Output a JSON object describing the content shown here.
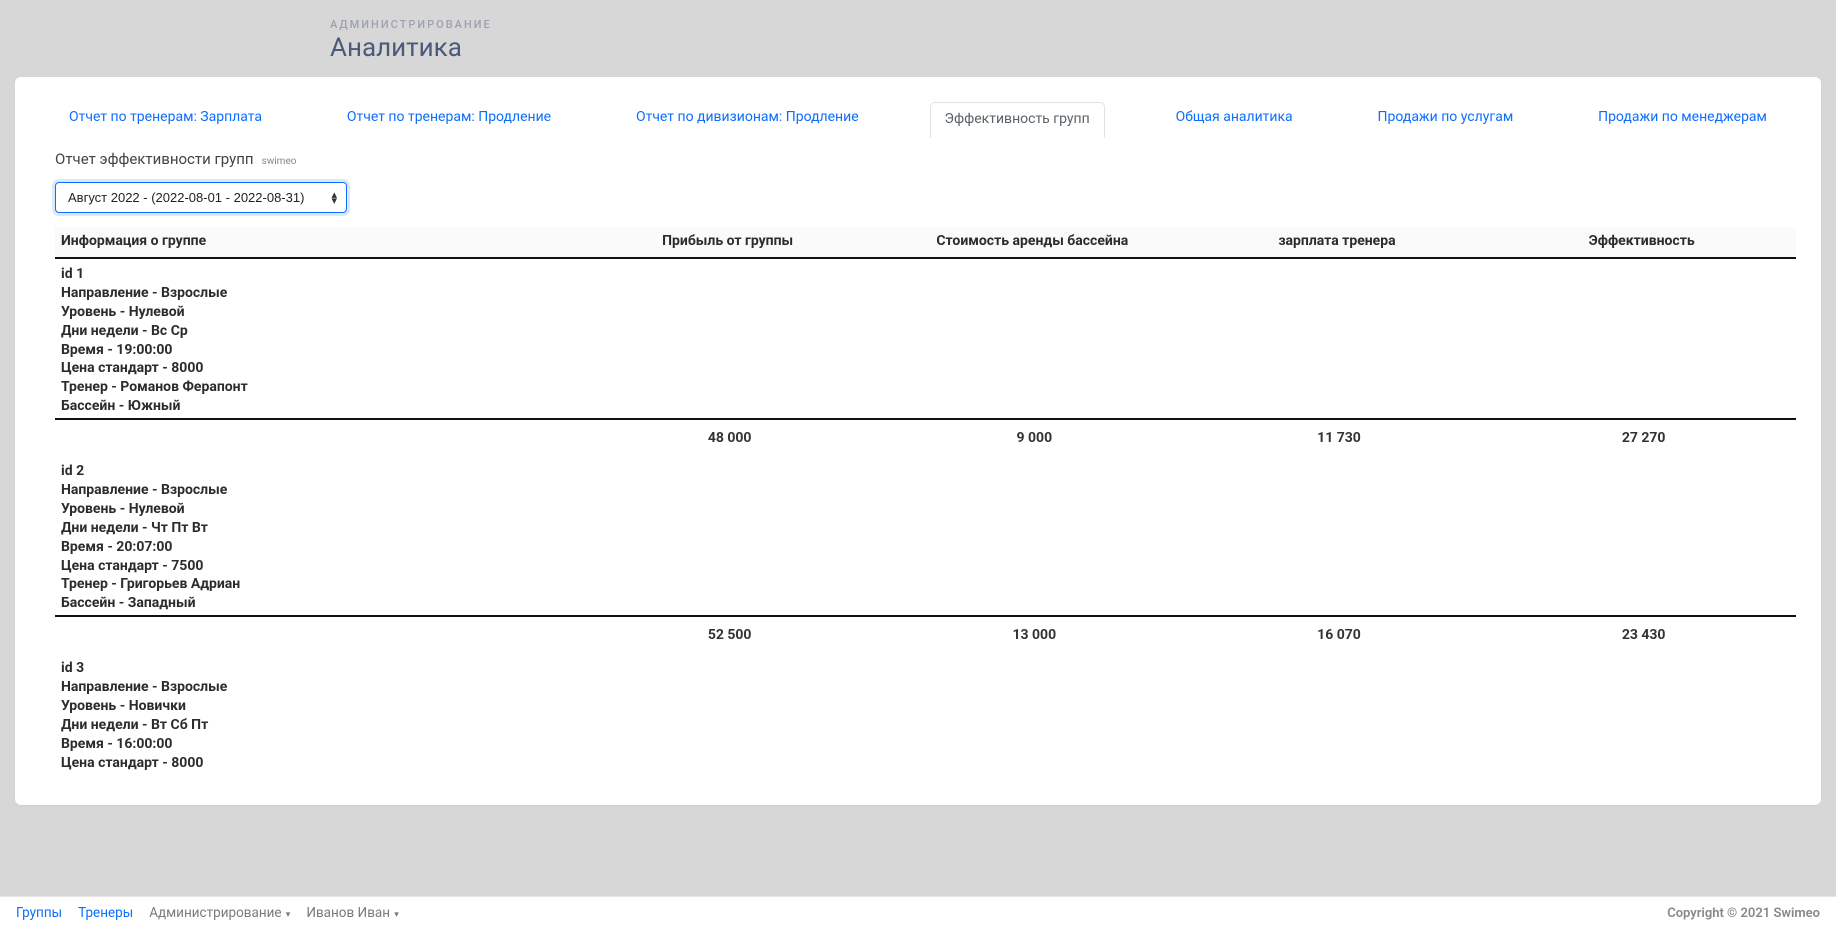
{
  "header": {
    "subtitle": "АДМИНИСТРИРОВАНИЕ",
    "title": "Аналитика"
  },
  "tabs": [
    {
      "label": "Отчет по тренерам: Зарплата",
      "active": false
    },
    {
      "label": "Отчет по тренерам: Продление",
      "active": false
    },
    {
      "label": "Отчет по дивизионам: Продление",
      "active": false
    },
    {
      "label": "Эффективность групп",
      "active": true
    },
    {
      "label": "Общая аналитика",
      "active": false
    },
    {
      "label": "Продажи по услугам",
      "active": false
    },
    {
      "label": "Продажи по менеджерам",
      "active": false
    }
  ],
  "report": {
    "title": "Отчет эффективности групп",
    "tag": "swimeo",
    "period_selected": "Август 2022 - (2022-08-01 - 2022-08-31)"
  },
  "table": {
    "headers": {
      "info": "Информация о группе",
      "profit": "Прибыль от группы",
      "rent": "Стоимость аренды бассейна",
      "salary": "зарплата тренера",
      "eff": "Эффективность"
    },
    "groups": [
      {
        "info": [
          "id 1",
          "Направление - Взрослые",
          "Уровень - Нулевой",
          "Дни недели - Вс Ср",
          "Время - 19:00:00",
          "Цена стандарт - 8000",
          "Тренер - Романов Ферапонт",
          "Бассейн - Южный"
        ],
        "profit": "48 000",
        "rent": "9 000",
        "salary": "11 730",
        "eff": "27 270"
      },
      {
        "info": [
          "id 2",
          "Направление - Взрослые",
          "Уровень - Нулевой",
          "Дни недели - Чт Пт Вт",
          "Время - 20:07:00",
          "Цена стандарт - 7500",
          "Тренер - Григорьев Адриан",
          "Бассейн - Западный"
        ],
        "profit": "52 500",
        "rent": "13 000",
        "salary": "16 070",
        "eff": "23 430"
      },
      {
        "info": [
          "id 3",
          "Направление - Взрослые",
          "Уровень - Новички",
          "Дни недели - Вт Сб Пт",
          "Время - 16:00:00",
          "Цена стандарт - 8000"
        ],
        "profit": "",
        "rent": "",
        "salary": "",
        "eff": ""
      }
    ]
  },
  "footer": {
    "links": {
      "groups": "Группы",
      "trainers": "Тренеры",
      "admin": "Администрирование",
      "user": "Иванов Иван"
    },
    "copyright": "Copyright © 2021 Swimeo"
  }
}
